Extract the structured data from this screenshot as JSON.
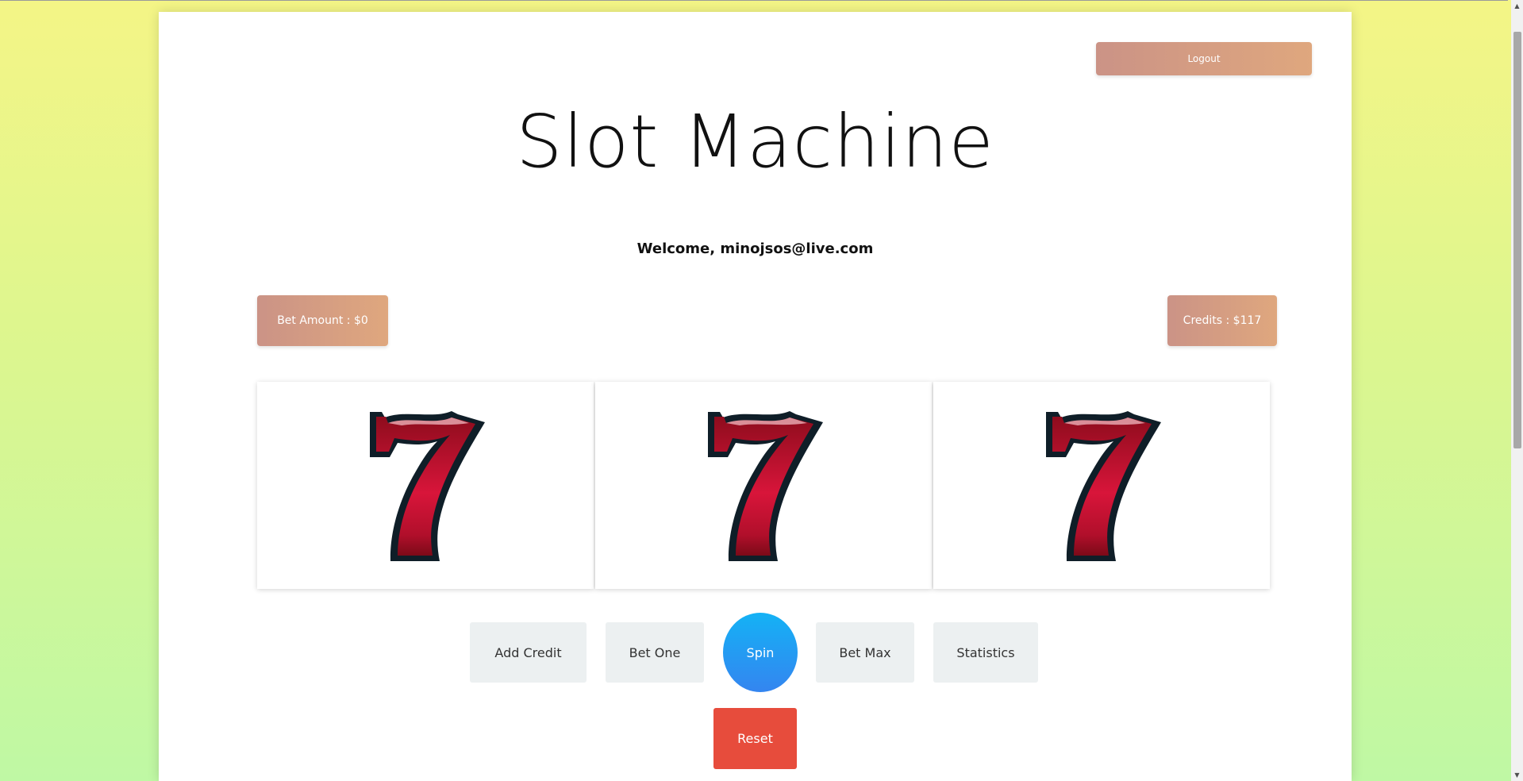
{
  "header": {
    "logout_label": "Logout",
    "title": "Slot Machine",
    "welcome": "Welcome, minojsos@live.com"
  },
  "status": {
    "bet_amount": "Bet Amount : $0",
    "credits": "Credits : $117"
  },
  "reels": [
    {
      "symbol": "seven-icon"
    },
    {
      "symbol": "seven-icon"
    },
    {
      "symbol": "seven-icon"
    }
  ],
  "controls": {
    "add_credit": "Add Credit",
    "bet_one": "Bet One",
    "spin": "Spin",
    "bet_max": "Bet Max",
    "statistics": "Statistics",
    "reset": "Reset"
  },
  "colors": {
    "accent_gradient_start": "#cb9386",
    "accent_gradient_end": "#dfa77e",
    "spin_start": "#14b2f5",
    "spin_end": "#3485f0",
    "reset": "#e74c3c",
    "seven_red": "#c8102e"
  },
  "scrollbar": {
    "thumb_fraction": 0.55
  }
}
